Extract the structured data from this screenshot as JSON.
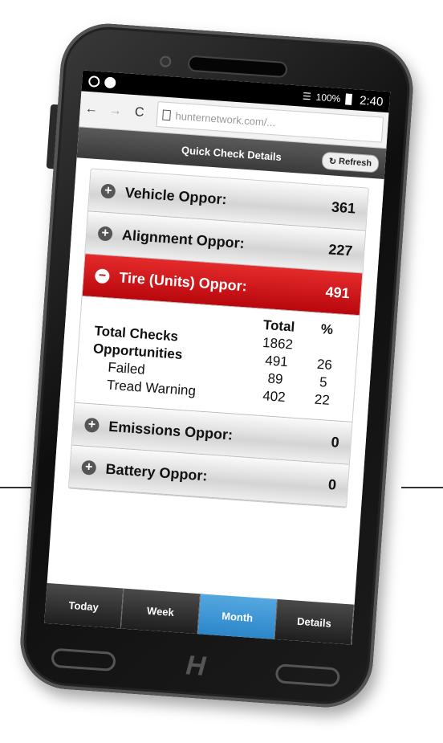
{
  "status_bar": {
    "signal": "☰",
    "battery": "100%",
    "time": "2:40"
  },
  "browser": {
    "back": "←",
    "forward": "→",
    "reload": "C",
    "url": "hunternetwork.com/..."
  },
  "header": {
    "title": "Quick Check Details",
    "refresh_label": "Refresh",
    "refresh_icon": "↻"
  },
  "rows": [
    {
      "label": "Vehicle Oppor:",
      "value": "361",
      "icon": "+"
    },
    {
      "label": "Alignment Oppor:",
      "value": "227",
      "icon": "+"
    },
    {
      "label": "Tire (Units) Oppor:",
      "value": "491",
      "icon": "−"
    },
    {
      "label": "Emissions Oppor:",
      "value": "0",
      "icon": "+"
    },
    {
      "label": "Battery Oppor:",
      "value": "0",
      "icon": "+"
    }
  ],
  "tire_detail": {
    "col_total": "Total",
    "col_pct": "%",
    "lines": [
      {
        "label": "Total Checks",
        "total": "1862",
        "pct": ""
      },
      {
        "label": "Opportunities",
        "total": "491",
        "pct": "26"
      },
      {
        "label": "Failed",
        "total": "89",
        "pct": "5"
      },
      {
        "label": "Tread Warning",
        "total": "402",
        "pct": "22"
      }
    ]
  },
  "tabs": [
    "Today",
    "Week",
    "Month",
    "Details"
  ],
  "active_tab": "Month",
  "accent_red": "#c4141a",
  "accent_blue": "#2b86c9"
}
